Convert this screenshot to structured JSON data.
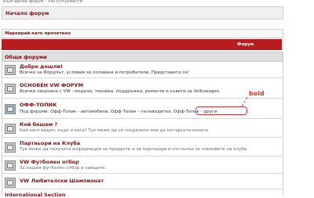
{
  "header": {
    "top_text": "Български форум : VW Ентусиасти",
    "breadcrumb": "Начало форум",
    "mark_read": "Маркирай като прочетено",
    "red_bar_label": "Форум",
    "category": "Общи форуми"
  },
  "forums": [
    {
      "name": "Добре дошли!",
      "description": "Всичко за Форумът, условия за ползване и потребители. Представете се!",
      "icon": "forum-icon"
    },
    {
      "name": "ОСНОВЕН VW ФОРУМ",
      "description": "Всичко свързано с VW - модели, техника, поддръжка, ремонти и съвети за Volkswagen.",
      "icon": "forum-icon"
    },
    {
      "name": "ОФФ-ТОПИК",
      "description_prefix": "Под форуми: ",
      "description": "Офф-Топик - автомобили, Офф-Топик - пътеводител, Офф-Топик - други",
      "icon": "forum-new-icon"
    },
    {
      "name": "Кой бешем ?",
      "description": "Кой кого видял, къде и кога? Тук може да се споделите или да потърсите колега.",
      "icon": "forum-icon"
    },
    {
      "name": "Партньори на Клуба",
      "description": "Тук може да получите информация за продукти и за партньори и отстъпки за членовете на клуба.",
      "icon": "forum-icon"
    },
    {
      "name": "VW Футболен отбор",
      "description": "За нашия футболен отбор и срещите.",
      "icon": "forum-icon"
    },
    {
      "name": "VW Любителски Шампионат",
      "description": "",
      "icon": "forum-icon"
    }
  ],
  "annotation": {
    "label": "bold",
    "color": "#d23a3a"
  },
  "bottom_category": "International Section"
}
